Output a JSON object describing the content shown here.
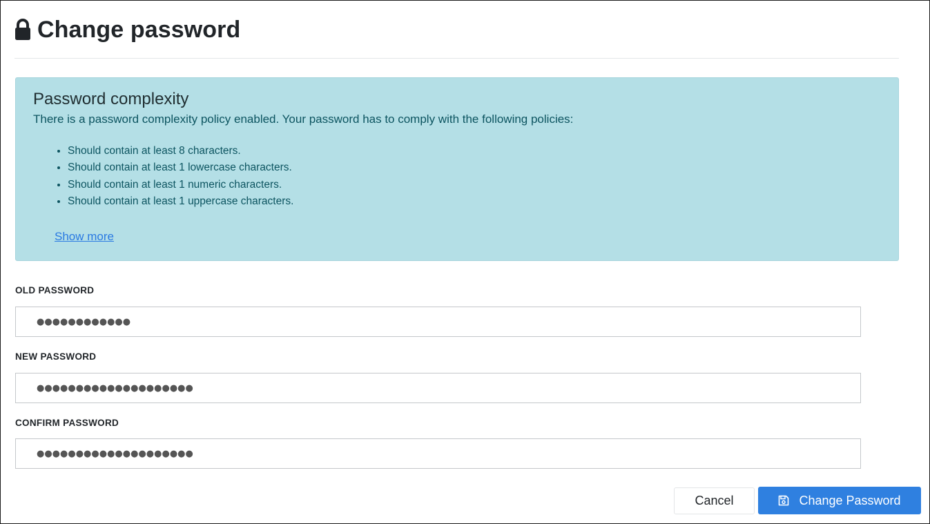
{
  "header": {
    "icon": "lock-icon",
    "title": "Change password"
  },
  "complexity": {
    "title": "Password complexity",
    "description": "There is a password complexity policy enabled. Your password has to comply with the following policies:",
    "policies": [
      "Should contain at least 8 characters.",
      "Should contain at least 1 lowercase characters.",
      "Should contain at least 1 numeric characters.",
      "Should contain at least 1 uppercase characters."
    ],
    "show_more_label": "Show more"
  },
  "form": {
    "old_password": {
      "label": "OLD PASSWORD",
      "value": "●●●●●●●●●●●●"
    },
    "new_password": {
      "label": "NEW PASSWORD",
      "value": "●●●●●●●●●●●●●●●●●●●●"
    },
    "confirm_password": {
      "label": "CONFIRM PASSWORD",
      "value": "●●●●●●●●●●●●●●●●●●●●"
    }
  },
  "actions": {
    "cancel_label": "Cancel",
    "submit_label": "Change Password",
    "submit_icon": "save-icon"
  },
  "colors": {
    "primary": "#2f80e0",
    "info_bg": "#b4dfe6",
    "info_text": "#0c5460",
    "link": "#2a7ae2"
  }
}
